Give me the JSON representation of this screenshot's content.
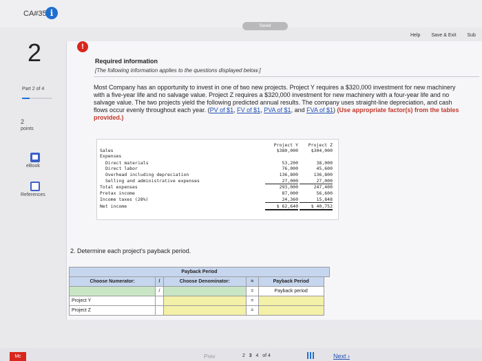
{
  "header": {
    "assignment": "CA#35",
    "saved": "Saved",
    "help": "Help",
    "save_exit": "Save & Exit",
    "submit": "Sub"
  },
  "sidebar": {
    "question_number": "2",
    "part": "Part 2 of 4",
    "part_progress": 0.25,
    "points_value": "2",
    "points_label": "points",
    "ebook": "eBook",
    "references": "References"
  },
  "content": {
    "required_info": "Required information",
    "note": "[The following information applies to the questions displayed below.]",
    "para_main": "Most Company has an opportunity to invest in one of two new projects. Project Y requires a $320,000 investment for new machinery with a five-year life and no salvage value. Project Z requires a $320,000 investment for new machinery with a four-year life and no salvage value. The two projects yield the following predicted annual results. The company uses straight-line depreciation, and cash flows occur evenly throughout each year. (",
    "link_pv": "PV of $1",
    "link_fv": "FV of $1",
    "link_pva": "PVA of $1",
    "and": "and",
    "link_fva": "FVA of $1",
    "instr": "(Use appropriate factor(s) from the tables provided.)"
  },
  "financials": {
    "col_y": "Project Y",
    "col_z": "Project Z",
    "rows": [
      {
        "label": "Sales",
        "y": "$380,000",
        "z": "$304,000"
      },
      {
        "label": "Expenses",
        "y": "",
        "z": ""
      },
      {
        "label": "Direct materials",
        "y": "53,200",
        "z": "38,000"
      },
      {
        "label": "Direct labor",
        "y": "76,000",
        "z": "45,600"
      },
      {
        "label": "Overhead including depreciation",
        "y": "136,800",
        "z": "136,800"
      },
      {
        "label": "Selling and administrative expenses",
        "y": "27,000",
        "z": "27,000"
      },
      {
        "label": "Total expenses",
        "y": "293,000",
        "z": "247,400"
      },
      {
        "label": "Pretax income",
        "y": "87,000",
        "z": "56,600"
      },
      {
        "label": "Income taxes (28%)",
        "y": "24,360",
        "z": "15,848"
      },
      {
        "label": "Net income",
        "y": "$ 62,640",
        "z": "$ 40,752"
      }
    ]
  },
  "question": {
    "text": "2. Determine each project's payback period."
  },
  "payback_table": {
    "title": "Payback Period",
    "numerator": "Choose Numerator:",
    "slash": "/",
    "denominator": "Choose Denominator:",
    "equals": "=",
    "result": "Payback Period",
    "result_sub": "Payback period",
    "row_y": "Project Y",
    "row_z": "Project Z"
  },
  "footer": {
    "logo": "Mc",
    "prev": "Prev",
    "page_prev": "2",
    "page_cur": "3",
    "page_next": "4",
    "of": "of 4",
    "next": "Next"
  }
}
